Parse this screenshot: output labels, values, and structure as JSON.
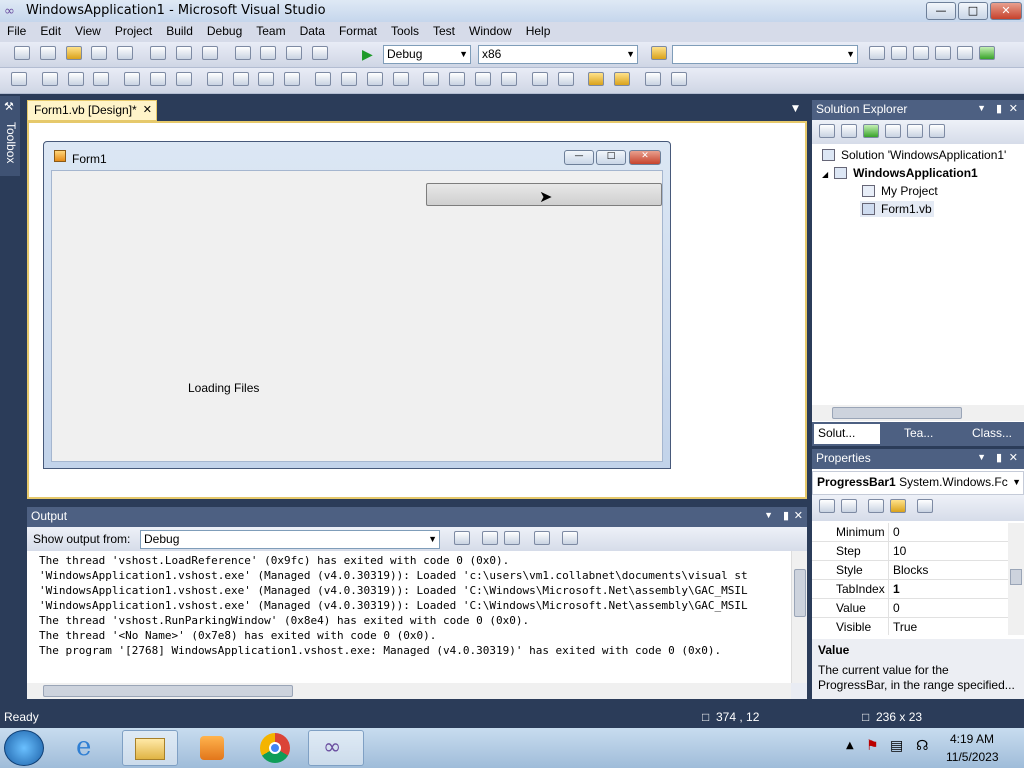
{
  "window": {
    "title": "WindowsApplication1 - Microsoft Visual Studio",
    "minimize": "—",
    "maximize": "□",
    "close": "✕"
  },
  "menu": [
    "File",
    "Edit",
    "View",
    "Project",
    "Build",
    "Debug",
    "Team",
    "Data",
    "Format",
    "Tools",
    "Test",
    "Window",
    "Help"
  ],
  "toolbar": {
    "config": "Debug",
    "platform": "x86",
    "find": ""
  },
  "toolbox": {
    "label": "Toolbox"
  },
  "document_tab": {
    "label": "Form1.vb [Design]*",
    "close": "✕"
  },
  "form": {
    "title": "Form1",
    "label_text": "Loading Files"
  },
  "solution_explorer": {
    "title": "Solution Explorer",
    "items": [
      {
        "label": "Solution 'WindowsApplication1'"
      },
      {
        "label": "WindowsApplication1"
      },
      {
        "label": "My Project"
      },
      {
        "label": "Form1.vb"
      }
    ],
    "tabs": [
      "Solut...",
      "Tea...",
      "Class..."
    ]
  },
  "properties": {
    "title": "Properties",
    "object": "ProgressBar1",
    "object_type": "System.Windows.Fc",
    "rows": [
      {
        "name": "Minimum",
        "value": "0"
      },
      {
        "name": "Step",
        "value": "10"
      },
      {
        "name": "Style",
        "value": "Blocks"
      },
      {
        "name": "TabIndex",
        "value": "1"
      },
      {
        "name": "Value",
        "value": "0"
      },
      {
        "name": "Visible",
        "value": "True"
      }
    ],
    "desc_title": "Value",
    "desc_text": "The current value for the ProgressBar, in the range specified..."
  },
  "output": {
    "title": "Output",
    "show_from_label": "Show output from:",
    "source": "Debug",
    "lines": [
      "The thread 'vshost.LoadReference' (0x9fc) has exited with code 0 (0x0).",
      "'WindowsApplication1.vshost.exe' (Managed (v4.0.30319)): Loaded 'c:\\users\\vm1.collabnet\\documents\\visual st",
      "'WindowsApplication1.vshost.exe' (Managed (v4.0.30319)): Loaded 'C:\\Windows\\Microsoft.Net\\assembly\\GAC_MSIL",
      "'WindowsApplication1.vshost.exe' (Managed (v4.0.30319)): Loaded 'C:\\Windows\\Microsoft.Net\\assembly\\GAC_MSIL",
      "The thread 'vshost.RunParkingWindow' (0x8e4) has exited with code 0 (0x0).",
      "The thread '<No Name>' (0x7e8) has exited with code 0 (0x0).",
      "The program '[2768] WindowsApplication1.vshost.exe: Managed (v4.0.30319)' has exited with code 0 (0x0)."
    ]
  },
  "status": {
    "text": "Ready",
    "position": "374 , 12",
    "size": "236 x 23"
  },
  "taskbar": {
    "time": "4:19 AM",
    "date": "11/5/2023"
  },
  "progress_bar": {
    "value": 0
  },
  "colors": {
    "accent": "#4d6082",
    "doc_tab": "#fff4c9",
    "titlebar": "#dfe9f5"
  }
}
